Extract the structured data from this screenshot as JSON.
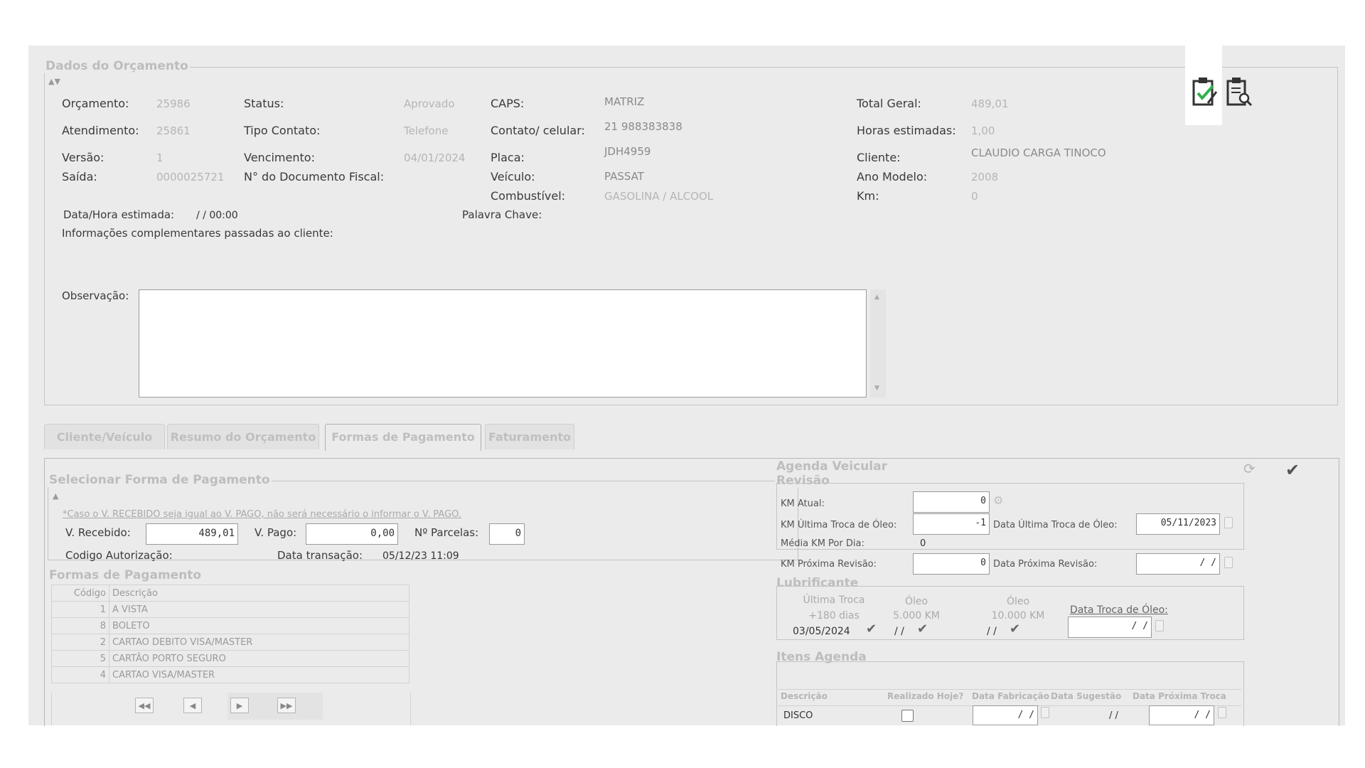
{
  "header": {
    "legend": "Dados do Orçamento"
  },
  "orcamento": {
    "orcamento_label": "Orçamento:",
    "orcamento_value": "25986",
    "atendimento_label": "Atendimento:",
    "atendimento_value": "25861",
    "versao_label": "Versão:",
    "versao_value": "1",
    "saida_label": "Saída:",
    "saida_value": "0000025721",
    "status_label": "Status:",
    "status_value": "Aprovado",
    "tipo_contato_label": "Tipo Contato:",
    "tipo_contato_value": "Telefone",
    "vencimento_label": "Vencimento:",
    "vencimento_value": "04/01/2024",
    "nf_label": "N° do Documento Fiscal:",
    "caps_label": "CAPS:",
    "caps_value": "MATRIZ",
    "contato_label": "Contato/ celular:",
    "contato_value": "21 988383838",
    "placa_label": "Placa:",
    "placa_value": "JDH4959",
    "veiculo_label": "Veículo:",
    "veiculo_value": "PASSAT",
    "combustivel_label": "Combustível:",
    "combustivel_value": "GASOLINA / ALCOOL",
    "total_label": "Total Geral:",
    "total_value": "489,01",
    "horas_label": "Horas estimadas:",
    "horas_value": "1,00",
    "cliente_label": "Cliente:",
    "cliente_value": "CLAUDIO  CARGA TINOCO",
    "ano_label": "Ano Modelo:",
    "ano_value": "2008",
    "km_label": "Km:",
    "km_value": "0",
    "data_hora_label": "Data/Hora estimada:",
    "data_hora_value": "/ / 00:00",
    "palavra_label": "Palavra Chave:",
    "info_label": "Informações complementares passadas ao cliente:",
    "obs_label": "Observação:",
    "obs_value": ""
  },
  "tabs": [
    "Cliente/Veículo",
    "Resumo do Orçamento",
    "Formas de Pagamento",
    "Faturamento"
  ],
  "active_tab": "Formas de Pagamento",
  "pagamento": {
    "legend": "Selecionar Forma de Pagamento",
    "note": "*Caso o V. RECEBIDO seja igual ao V. PAGO, não será necessário o informar o V. PAGO.",
    "recebido_label": "V. Recebido:",
    "recebido_value": "489,01",
    "pago_label": "V. Pago:",
    "pago_value": "0,00",
    "parcelas_label": "Nº Parcelas:",
    "parcelas_value": "0",
    "autorizacao_label": "Codigo Autorização:",
    "transacao_label": "Data transação:",
    "transacao_value": "05/12/23 11:09"
  },
  "formas": {
    "legend": "Formas de Pagamento",
    "col_codigo": "Código",
    "col_descricao": "Descrição",
    "rows": [
      {
        "codigo": "1",
        "descricao": "A VISTA"
      },
      {
        "codigo": "8",
        "descricao": "BOLETO"
      },
      {
        "codigo": "2",
        "descricao": "CARTAO DEBITO VISA/MASTER"
      },
      {
        "codigo": "5",
        "descricao": "CARTÃO PORTO SEGURO"
      },
      {
        "codigo": "4",
        "descricao": "CARTAO VISA/MASTER"
      }
    ]
  },
  "agenda": {
    "legend": "Agenda Veicular",
    "revisao_legend": "Revisão",
    "km_atual_label": "KM Atual:",
    "km_atual_value": "0",
    "km_ultima_label": "KM Última Troca de Óleo:",
    "km_ultima_value": "-1",
    "data_ultima_label": "Data Última Troca de Óleo:",
    "data_ultima_value": "05/11/2023",
    "media_label": "Média KM Por Dia:",
    "media_value": "0",
    "km_proxima_label": "KM Próxima Revisão:",
    "km_proxima_value": "0",
    "data_proxima_label": "Data Próxima Revisão:",
    "data_proxima_value": "/ /",
    "lub_legend": "Lubrificante",
    "ultima_troca_label": "Última Troca",
    "ultima_troca_sub": "+180 dias",
    "ultima_troca_value": "03/05/2024",
    "oleo5_label": "Óleo",
    "oleo5_sub": "5.000 KM",
    "oleo5_value": "/ /",
    "oleo10_label": "Óleo",
    "oleo10_sub": "10.000 KM",
    "oleo10_value": "/ /",
    "data_troca_label": "Data Troca de Óleo:",
    "data_troca_value": "/ /",
    "itens_legend": "Itens Agenda",
    "col_descricao": "Descrição",
    "col_realizado": "Realizado Hoje?",
    "col_fabricacao": "Data Fabricação",
    "col_sugestao": "Data Sugestão",
    "col_proxima": "Data Próxima Troca",
    "item_descricao": "DISCO",
    "item_fabricacao": "/ /",
    "item_sugestao": "/ /",
    "item_proxima": "/ /"
  }
}
